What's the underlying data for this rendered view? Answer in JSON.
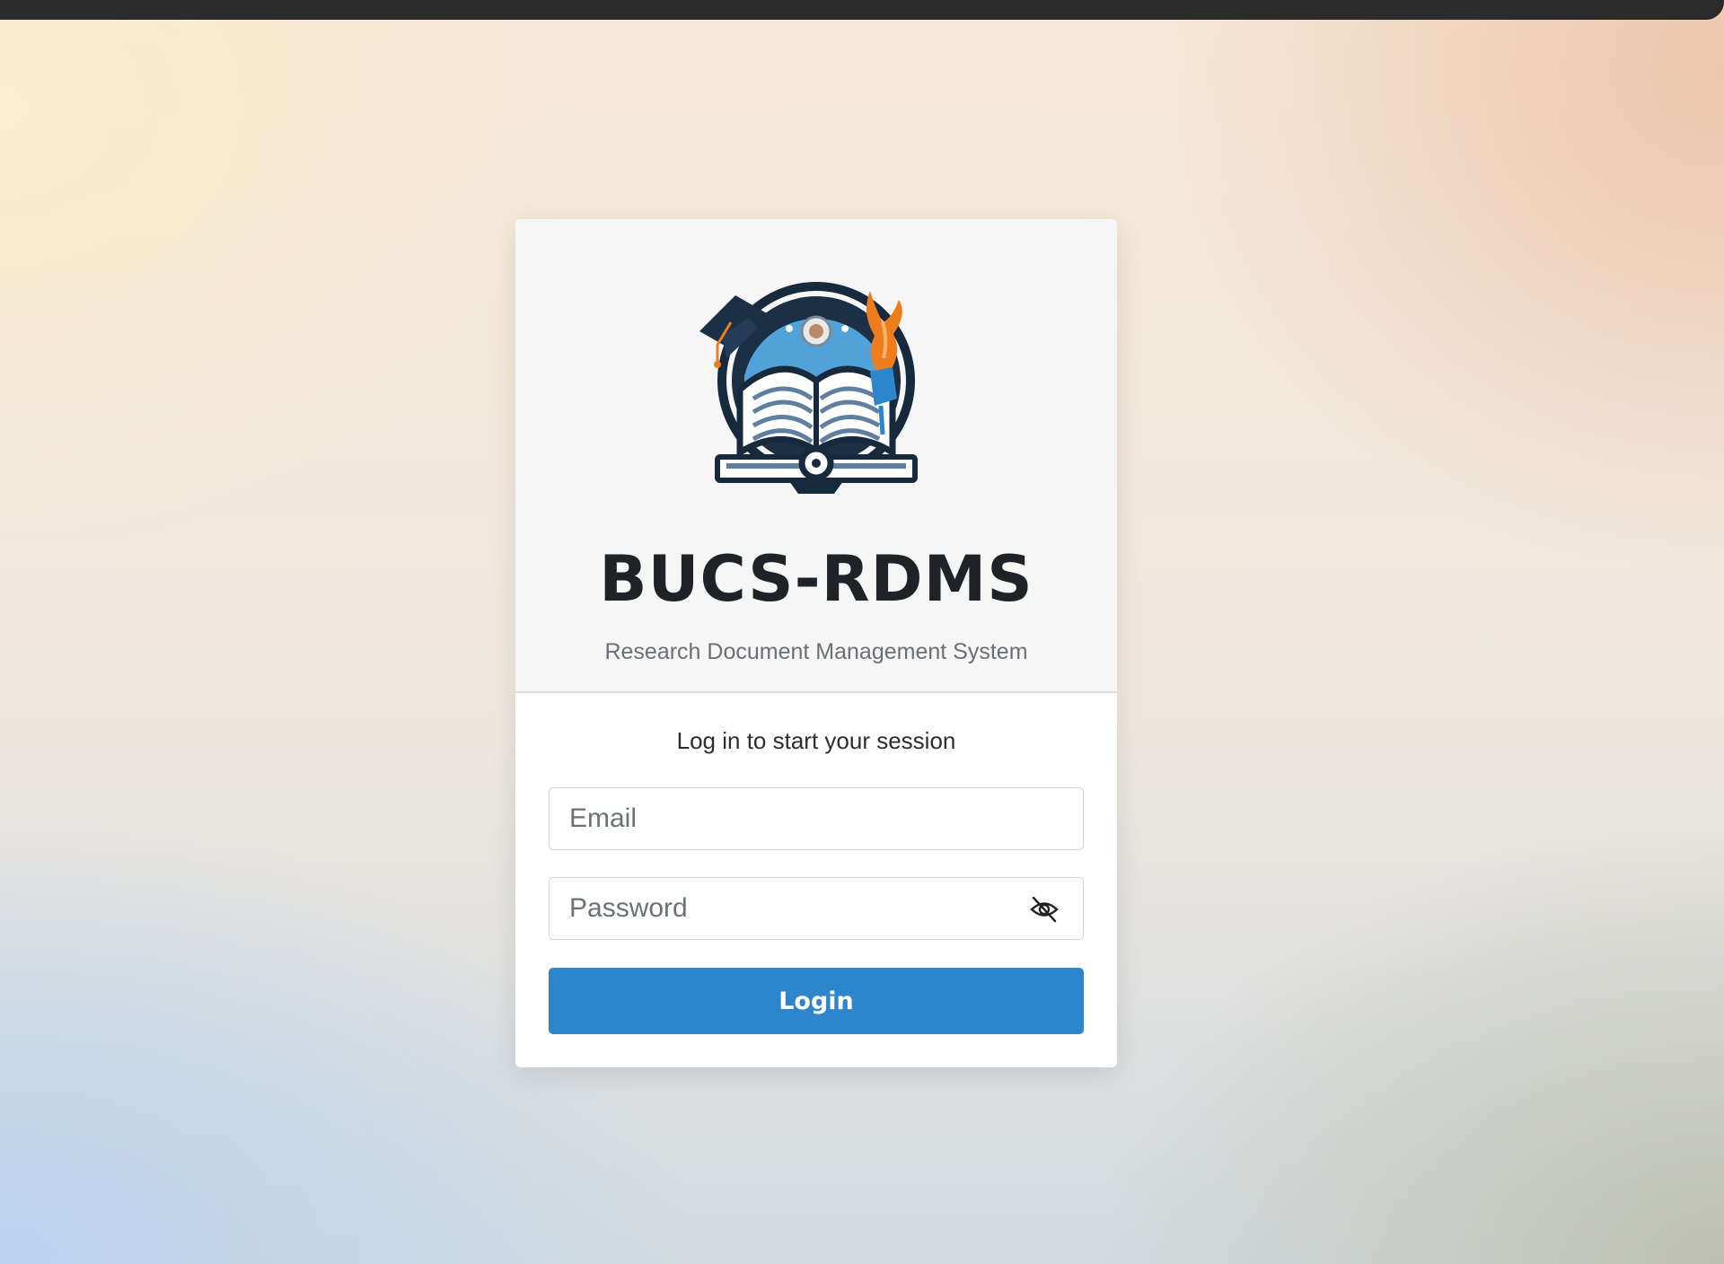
{
  "app": {
    "title": "BUCS-RDMS",
    "subtitle": "Research Document Management System"
  },
  "login": {
    "message": "Log in to start your session",
    "email_placeholder": "Email",
    "password_placeholder": "Password",
    "password_toggle_icon": "eye-slash-icon",
    "submit_label": "Login"
  },
  "colors": {
    "primary": "#2d85cc",
    "title": "#1f2328",
    "subtitle": "#6c6f74"
  }
}
